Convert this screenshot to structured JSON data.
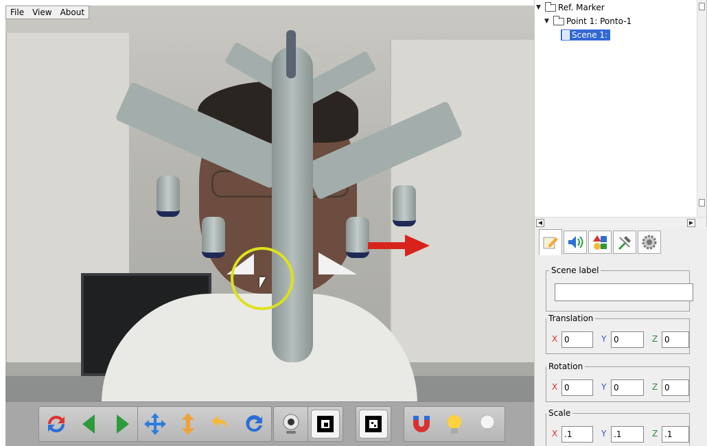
{
  "menubar": {
    "items": [
      "File",
      "View",
      "About"
    ]
  },
  "tree": {
    "root": {
      "label": "Ref. Marker",
      "expanded": true
    },
    "point": {
      "label": "Point 1: Ponto-1",
      "expanded": true
    },
    "scene": {
      "label": "Scene 1:",
      "selected": true
    }
  },
  "tabs": [
    {
      "icon": "pencil-icon",
      "active": true
    },
    {
      "icon": "speaker-icon",
      "active": false
    },
    {
      "icon": "shapes-icon",
      "active": false
    },
    {
      "icon": "tools-icon",
      "active": false
    },
    {
      "icon": "gear-icon",
      "active": false
    }
  ],
  "scene_label": {
    "title": "Scene label",
    "value": ""
  },
  "translation": {
    "title": "Translation",
    "x_label": "X",
    "y_label": "Y",
    "z_label": "Z",
    "x": "0",
    "y": "0",
    "z": "0"
  },
  "rotation": {
    "title": "Rotation",
    "x_label": "X",
    "y_label": "Y",
    "z_label": "Z",
    "x": "0",
    "y": "0",
    "z": "0"
  },
  "scale": {
    "title": "Scale",
    "x_label": "X",
    "y_label": "Y",
    "z_label": "Z",
    "x": ".1",
    "y": ".1",
    "z": ".1"
  },
  "toolbar": {
    "buttons": [
      "refresh-icon",
      "previous-icon",
      "next-icon",
      "move-icon",
      "move-vertical-icon",
      "undo-icon",
      "redo-icon",
      "webcam-icon",
      "marker-icon",
      "marker-alt-icon",
      "magnet-icon",
      "light-on-icon",
      "light-off-icon"
    ]
  },
  "colors": {
    "selection": "#3168d5",
    "ring": "#dde21a",
    "arrow": "#d7231c",
    "x_axis": "#d43030",
    "y_axis": "#3a52c0",
    "z_axis": "#2f8a3a"
  }
}
